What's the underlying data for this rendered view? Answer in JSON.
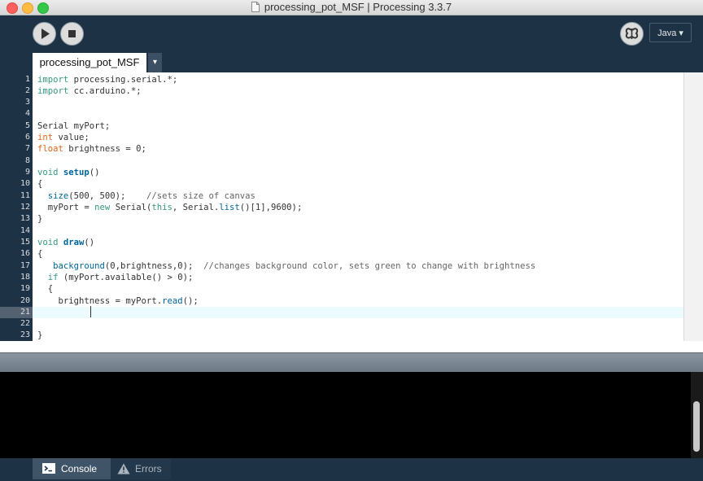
{
  "window": {
    "title": "processing_pot_MSF | Processing 3.3.7"
  },
  "toolbar": {
    "mode": "Java ▾"
  },
  "tabs": {
    "main": "processing_pot_MSF",
    "menu": "▾"
  },
  "editor": {
    "line_numbers": [
      "1",
      "2",
      "3",
      "4",
      "5",
      "6",
      "7",
      "8",
      "9",
      "10",
      "11",
      "12",
      "13",
      "14",
      "15",
      "16",
      "17",
      "18",
      "19",
      "20",
      "21",
      "22",
      "23"
    ],
    "current_line": "21"
  },
  "footer": {
    "console": "Console",
    "errors": "Errors"
  },
  "colors": {
    "background": "#1e3246",
    "keyword": "#33997e",
    "function": "#006699",
    "type": "#e2661a",
    "comment": "#666666"
  }
}
